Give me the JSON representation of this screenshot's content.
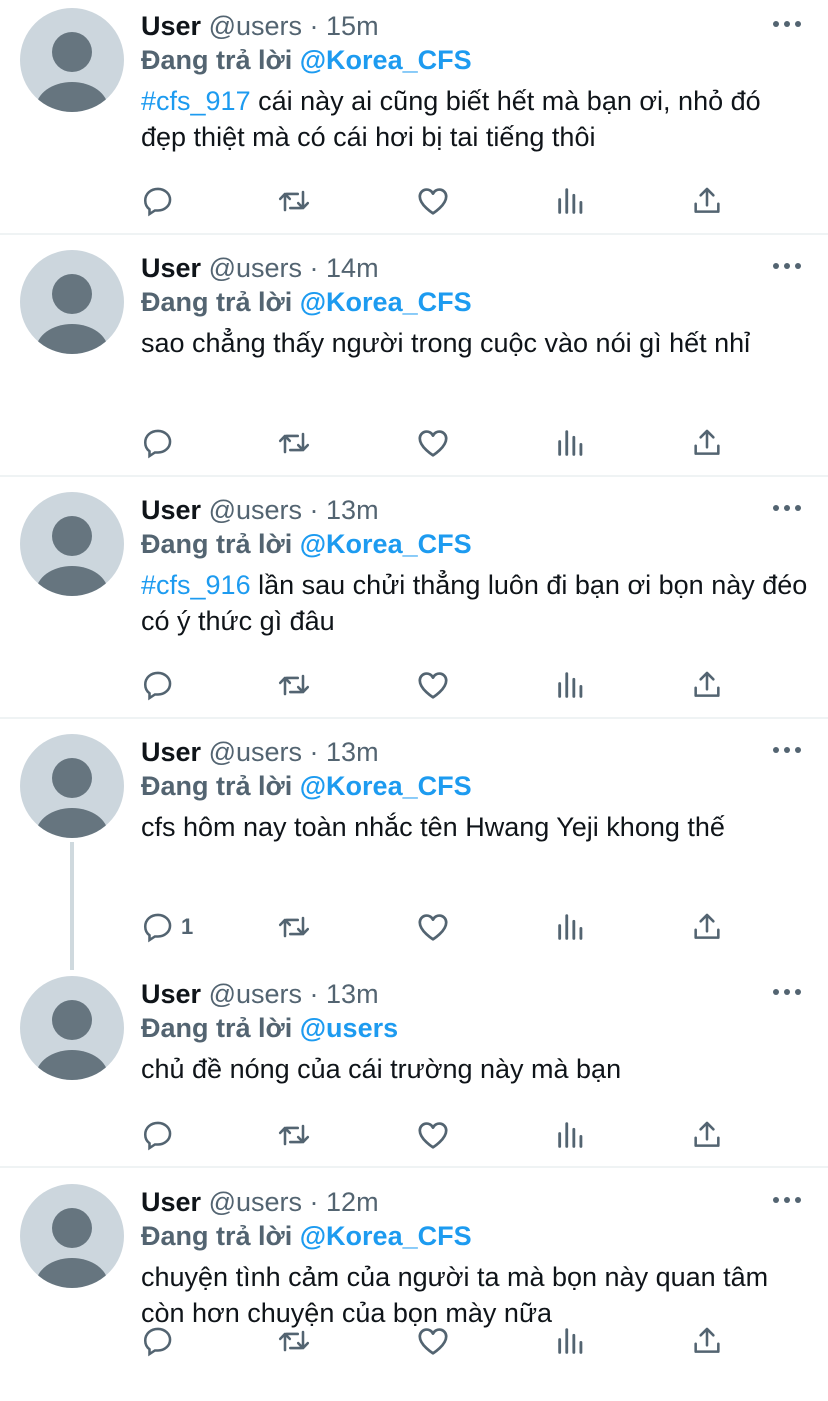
{
  "colors": {
    "accent": "#1d9bf0",
    "secondary_text": "#536471",
    "primary_text": "#0f1419",
    "avatar_bg": "#ccd6dd",
    "avatar_fg": "#66757f"
  },
  "tweets": [
    {
      "name": "User",
      "handle": "@users",
      "time": "15m",
      "replying_label": "Đang trả lời",
      "replying_to": "@Korea_CFS",
      "hashtag": "#cfs_917",
      "text": "cái này ai cũng biết hết mà bạn ơi, nhỏ đó đẹp thiệt mà có cái hơi bị tai tiếng thôi",
      "reply_count": ""
    },
    {
      "name": "User",
      "handle": "@users",
      "time": "14m",
      "replying_label": "Đang trả lời",
      "replying_to": "@Korea_CFS",
      "hashtag": "",
      "text": "sao chẳng thấy người trong cuộc vào nói gì hết nhỉ",
      "reply_count": ""
    },
    {
      "name": "User",
      "handle": "@users",
      "time": "13m",
      "replying_label": "Đang trả lời",
      "replying_to": "@Korea_CFS",
      "hashtag": "#cfs_916",
      "text": "lần sau chửi thẳng luôn đi bạn ơi bọn này đéo có ý thức gì đâu",
      "reply_count": ""
    },
    {
      "name": "User",
      "handle": "@users",
      "time": "13m",
      "replying_label": "Đang trả lời",
      "replying_to": "@Korea_CFS",
      "hashtag": "",
      "text": "cfs hôm nay toàn nhắc tên Hwang Yeji khong thế",
      "reply_count": "1"
    },
    {
      "name": "User",
      "handle": "@users",
      "time": "13m",
      "replying_label": "Đang trả lời",
      "replying_to": "@users",
      "hashtag": "",
      "text": "chủ đề nóng của cái trường này mà bạn",
      "reply_count": ""
    },
    {
      "name": "User",
      "handle": "@users",
      "time": "12m",
      "replying_label": "Đang trả lời",
      "replying_to": "@Korea_CFS",
      "hashtag": "",
      "text": "chuyện tình cảm của người ta mà bọn này quan tâm còn hơn chuyện của bọn mày nữa",
      "reply_count": ""
    }
  ],
  "icons": [
    "reply-icon",
    "retweet-icon",
    "like-icon",
    "analytics-icon",
    "share-icon",
    "more-icon"
  ]
}
